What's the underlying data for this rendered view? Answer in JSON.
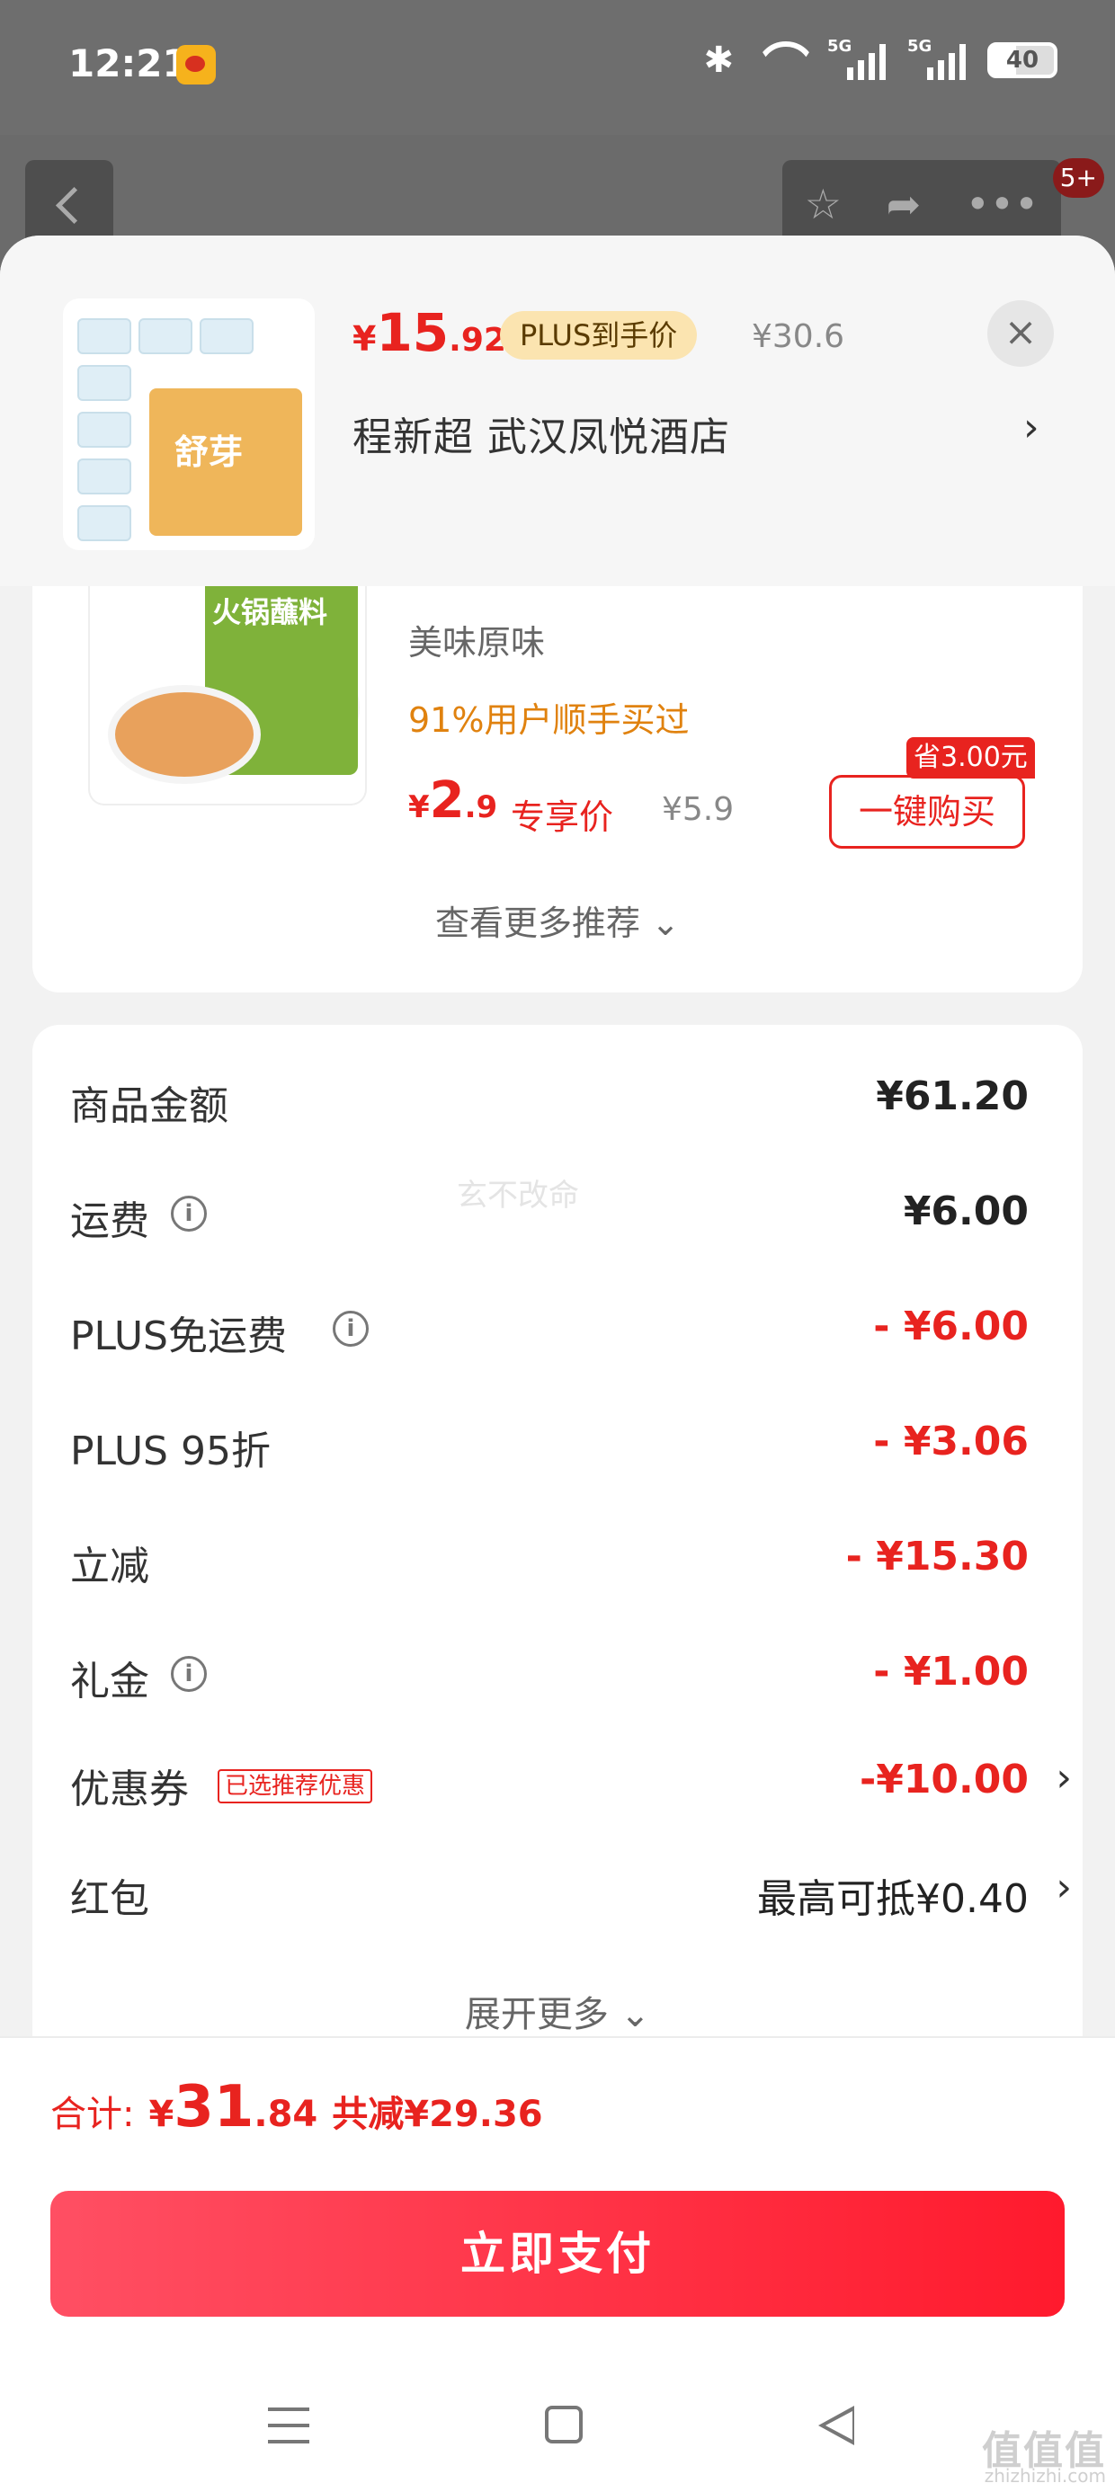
{
  "status_bar": {
    "time": "12:21",
    "signal_label_1": "5G",
    "signal_label_2": "5G",
    "battery": "40"
  },
  "header": {
    "notification_badge": "5+",
    "more_icon": "•••"
  },
  "product": {
    "price_symbol": "¥",
    "price_int": "15",
    "price_dec": ".92",
    "plus_tag": "PLUS到手价",
    "original_price": "¥30.6",
    "image_brand": "舒芽",
    "address": "程新超  武汉凤悦酒店",
    "address_arrow": "›",
    "close": "×"
  },
  "recommendation": {
    "image_label": "火锅蘸料",
    "name": "美味原味",
    "bought": "91%用户顺手买过",
    "price_symbol": "¥",
    "price_int": "2",
    "price_dec": ".9",
    "exclusive": "专享价",
    "original_price": "¥5.9",
    "save_tag": "省3.00元",
    "buy_button": "一键购买",
    "more": "查看更多推荐 ⌄"
  },
  "fees": [
    {
      "label": "商品金额",
      "value": "¥61.20",
      "color": "normal",
      "info": false
    },
    {
      "label": "运费",
      "value": "¥6.00",
      "color": "normal",
      "info": true
    },
    {
      "label": "PLUS免运费",
      "value": "- ¥6.00",
      "color": "red",
      "info": true
    },
    {
      "label": "PLUS 95折",
      "value": "- ¥3.06",
      "color": "red",
      "info": false
    },
    {
      "label": "立减",
      "value": "- ¥15.30",
      "color": "red",
      "info": false
    },
    {
      "label": "礼金",
      "value": "- ¥1.00",
      "color": "red",
      "info": true
    },
    {
      "label": "优惠券",
      "tag": "已选推荐优惠",
      "value": "-¥10.00",
      "color": "red",
      "chevron": "›"
    },
    {
      "label": "红包",
      "value": "最高可抵¥0.40",
      "color": "normal",
      "chevron": "›"
    }
  ],
  "expand_more": "展开更多 ⌄",
  "watermark": "玄不改命",
  "footer": {
    "total_label": "合计:",
    "total_symbol": "¥",
    "total_int": "31",
    "total_dec": ".84",
    "total_reduced": "共减¥29.36",
    "pay_button": "立即支付"
  },
  "site_mark": "值值值",
  "site_url": "zhizhizhi.com",
  "colors": {
    "accent_red": "#e8231f",
    "plus_gold": "#fbe4b0",
    "pay_gradient_start": "#ff4f63",
    "pay_gradient_end": "#ff1a2d"
  }
}
